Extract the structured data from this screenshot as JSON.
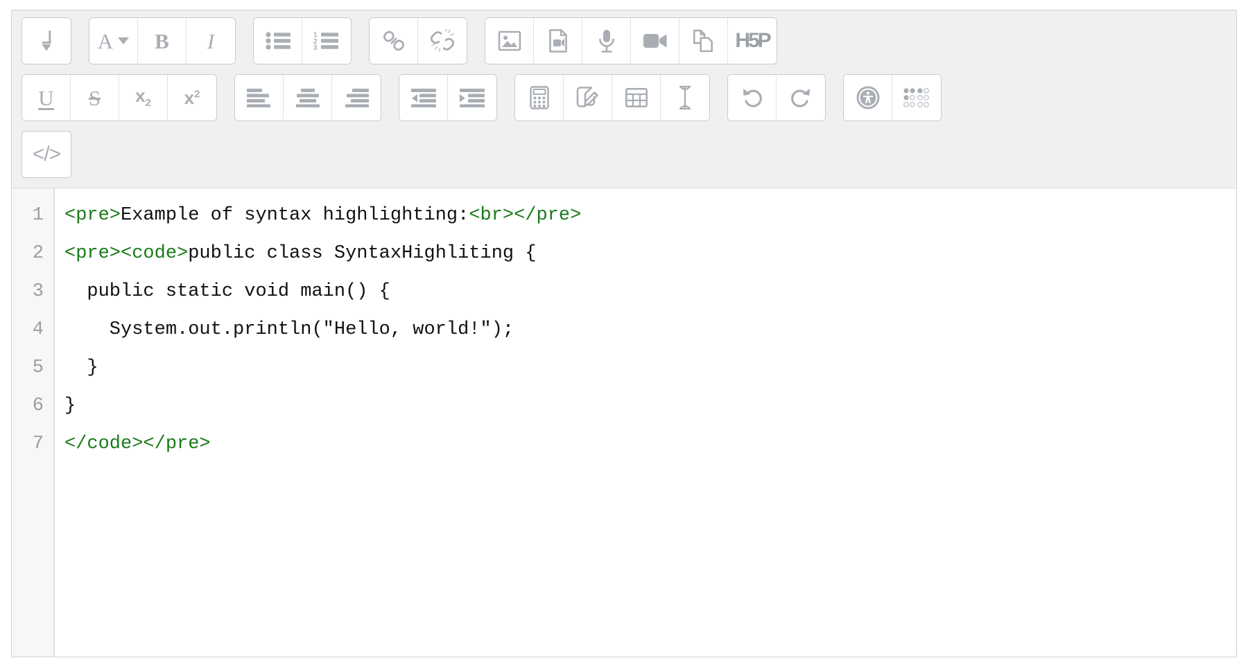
{
  "editor": {
    "name": "rich-text-editor",
    "source_view_active": true,
    "colors": {
      "toolbar_bg": "#f0f0f0",
      "button_bg": "#ffffff",
      "icon_gray": "#a9aeb4",
      "tag_green": "#1a7a1a",
      "text_black": "#111111",
      "gutter_gray": "#9d9d9d"
    }
  },
  "toolbar": {
    "rows": [
      {
        "groups": [
          {
            "buttons": [
              {
                "name": "line-break-button",
                "icon": "line-break-icon",
                "label": "Line break"
              }
            ]
          },
          {
            "buttons": [
              {
                "name": "font-style-button",
                "icon": "font-style-icon",
                "label": "A"
              },
              {
                "name": "bold-button",
                "icon": "bold-icon",
                "label": "B"
              },
              {
                "name": "italic-button",
                "icon": "italic-icon",
                "label": "I"
              }
            ]
          },
          {
            "buttons": [
              {
                "name": "bulleted-list-button",
                "icon": "bulleted-list-icon",
                "label": "Bulleted list"
              },
              {
                "name": "numbered-list-button",
                "icon": "numbered-list-icon",
                "label": "Numbered list"
              }
            ]
          },
          {
            "buttons": [
              {
                "name": "insert-link-button",
                "icon": "link-icon",
                "label": "Link"
              },
              {
                "name": "unlink-button",
                "icon": "unlink-icon",
                "label": "Unlink"
              }
            ]
          },
          {
            "buttons": [
              {
                "name": "insert-image-button",
                "icon": "image-icon",
                "label": "Image"
              },
              {
                "name": "insert-media-button",
                "icon": "media-file-icon",
                "label": "Media"
              },
              {
                "name": "record-audio-button",
                "icon": "microphone-icon",
                "label": "Record audio"
              },
              {
                "name": "record-video-button",
                "icon": "video-camera-icon",
                "label": "Record video"
              },
              {
                "name": "manage-files-button",
                "icon": "copy-files-icon",
                "label": "Manage files"
              },
              {
                "name": "h5p-button",
                "icon": "h5p-icon",
                "label": "H5P"
              }
            ]
          }
        ]
      },
      {
        "groups": [
          {
            "buttons": [
              {
                "name": "underline-button",
                "icon": "underline-icon",
                "label": "U"
              },
              {
                "name": "strikethrough-button",
                "icon": "strikethrough-icon",
                "label": "S"
              },
              {
                "name": "subscript-button",
                "icon": "subscript-icon",
                "label": "x2"
              },
              {
                "name": "superscript-button",
                "icon": "superscript-icon",
                "label": "x2"
              }
            ]
          },
          {
            "buttons": [
              {
                "name": "align-left-button",
                "icon": "align-left-icon",
                "label": "Align left"
              },
              {
                "name": "align-center-button",
                "icon": "align-center-icon",
                "label": "Align center"
              },
              {
                "name": "align-right-button",
                "icon": "align-right-icon",
                "label": "Align right"
              }
            ]
          },
          {
            "buttons": [
              {
                "name": "outdent-button",
                "icon": "outdent-icon",
                "label": "Decrease indent"
              },
              {
                "name": "indent-button",
                "icon": "indent-icon",
                "label": "Increase indent"
              }
            ]
          },
          {
            "buttons": [
              {
                "name": "equation-button",
                "icon": "calculator-icon",
                "label": "Equation editor"
              },
              {
                "name": "draw-button",
                "icon": "pencil-box-icon",
                "label": "Draw"
              },
              {
                "name": "insert-table-button",
                "icon": "table-icon",
                "label": "Table"
              },
              {
                "name": "clear-formatting-button",
                "icon": "text-cursor-icon",
                "label": "Clear formatting"
              }
            ]
          },
          {
            "buttons": [
              {
                "name": "undo-button",
                "icon": "undo-icon",
                "label": "Undo"
              },
              {
                "name": "redo-button",
                "icon": "redo-icon",
                "label": "Redo"
              }
            ]
          },
          {
            "buttons": [
              {
                "name": "accessibility-checker-button",
                "icon": "accessibility-icon",
                "label": "Accessibility checker"
              },
              {
                "name": "screenreader-helper-button",
                "icon": "braille-dots-icon",
                "label": "Screenreader helper"
              }
            ]
          }
        ]
      },
      {
        "groups": [
          {
            "buttons": [
              {
                "name": "source-code-button",
                "icon": "code-brackets-icon",
                "label": "</>"
              }
            ]
          }
        ]
      }
    ]
  },
  "source_code": {
    "language": "html",
    "line_numbers": [
      "1",
      "2",
      "3",
      "4",
      "5",
      "6",
      "7"
    ],
    "lines": [
      [
        {
          "t": "tag",
          "s": "<pre>"
        },
        {
          "t": "plain",
          "s": "Example of syntax highlighting:"
        },
        {
          "t": "tag",
          "s": "<br></pre>"
        }
      ],
      [
        {
          "t": "tag",
          "s": "<pre><code>"
        },
        {
          "t": "plain",
          "s": "public class SyntaxHighliting {"
        }
      ],
      [
        {
          "t": "plain",
          "s": "  public static void main() {"
        }
      ],
      [
        {
          "t": "plain",
          "s": "    System.out.println(\"Hello, world!\");"
        }
      ],
      [
        {
          "t": "plain",
          "s": "  }"
        }
      ],
      [
        {
          "t": "plain",
          "s": "}"
        }
      ],
      [
        {
          "t": "tag",
          "s": "</code></pre>"
        }
      ]
    ]
  }
}
